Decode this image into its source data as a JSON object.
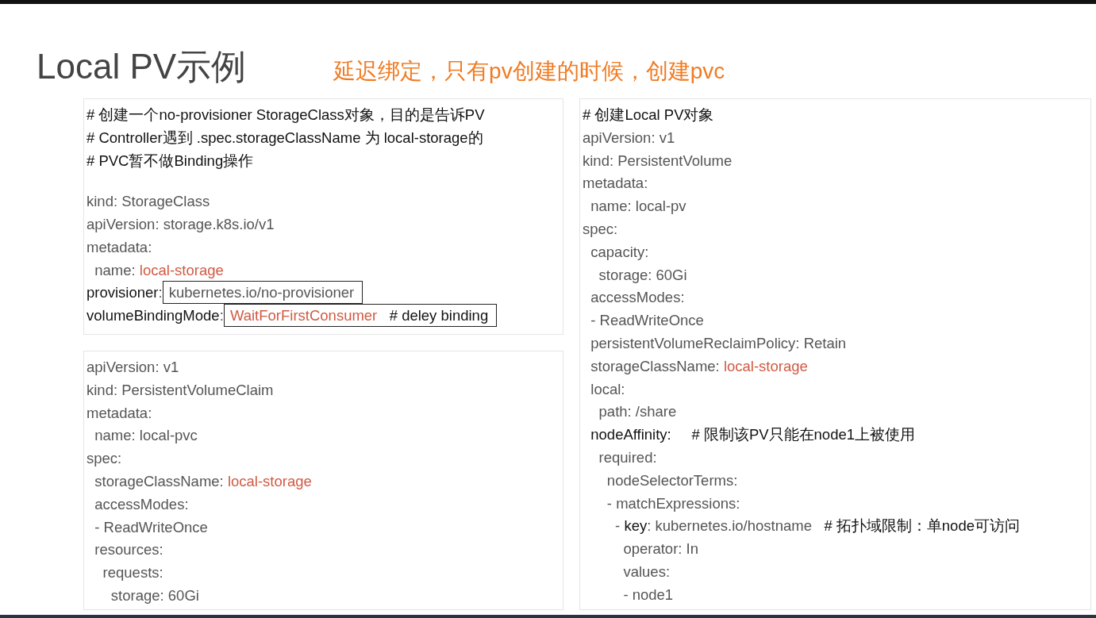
{
  "slide": {
    "title": "Local PV示例",
    "note": "延迟绑定，只有pv创建的时候，创建pvc",
    "left_panels": [
      {
        "lines": [
          {
            "kind": "code",
            "parts": [
              {
                "kind": "comment",
                "text": "# 创建一个no-provisioner StorageClass对象，目的是告诉PV"
              }
            ]
          },
          {
            "kind": "code",
            "parts": [
              {
                "kind": "comment",
                "text": "# Controller遇到 .spec.storageClassName 为 local-storage的"
              }
            ]
          },
          {
            "kind": "code",
            "parts": [
              {
                "kind": "comment",
                "text": "# PVC暂不做Binding操作"
              }
            ]
          },
          {
            "kind": "blank"
          },
          {
            "kind": "code",
            "parts": [
              {
                "kind": "plain",
                "text": "kind: StorageClass"
              }
            ]
          },
          {
            "kind": "code",
            "parts": [
              {
                "kind": "plain",
                "text": "apiVersion: storage.k8s.io/v1"
              }
            ]
          },
          {
            "kind": "code",
            "parts": [
              {
                "kind": "plain",
                "text": "metadata:"
              }
            ]
          },
          {
            "kind": "code",
            "parts": [
              {
                "kind": "plain",
                "text": "  name: "
              },
              {
                "kind": "value",
                "text": "local-storage"
              }
            ]
          },
          {
            "kind": "code",
            "parts": [
              {
                "kind": "key",
                "text": "provisioner"
              },
              {
                "kind": "plain",
                "text": ":"
              },
              {
                "kind": "box",
                "parts": [
                  {
                    "kind": "plain",
                    "text": " kubernetes.io/no-provisioner"
                  }
                ]
              }
            ]
          },
          {
            "kind": "code",
            "parts": [
              {
                "kind": "key",
                "text": "volumeBindingMode"
              },
              {
                "kind": "plain",
                "text": ":"
              },
              {
                "kind": "box",
                "parts": [
                  {
                    "kind": "value",
                    "text": " WaitForFirstConsumer"
                  },
                  {
                    "kind": "comment",
                    "text": "   # deley binding"
                  }
                ]
              }
            ]
          }
        ]
      },
      {
        "lines": [
          {
            "kind": "code",
            "parts": [
              {
                "kind": "plain",
                "text": "apiVersion: v1"
              }
            ]
          },
          {
            "kind": "code",
            "parts": [
              {
                "kind": "plain",
                "text": "kind: PersistentVolumeClaim"
              }
            ]
          },
          {
            "kind": "code",
            "parts": [
              {
                "kind": "plain",
                "text": "metadata:"
              }
            ]
          },
          {
            "kind": "code",
            "parts": [
              {
                "kind": "plain",
                "text": "  name: local-pvc"
              }
            ]
          },
          {
            "kind": "code",
            "parts": [
              {
                "kind": "plain",
                "text": "spec:"
              }
            ]
          },
          {
            "kind": "code",
            "parts": [
              {
                "kind": "plain",
                "text": "  storageClassName: "
              },
              {
                "kind": "value",
                "text": "local-storage"
              }
            ]
          },
          {
            "kind": "code",
            "parts": [
              {
                "kind": "plain",
                "text": "  accessModes:"
              }
            ]
          },
          {
            "kind": "code",
            "parts": [
              {
                "kind": "plain",
                "text": "  - ReadWriteOnce"
              }
            ]
          },
          {
            "kind": "code",
            "parts": [
              {
                "kind": "plain",
                "text": "  resources:"
              }
            ]
          },
          {
            "kind": "code",
            "parts": [
              {
                "kind": "plain",
                "text": "    requests:"
              }
            ]
          },
          {
            "kind": "code",
            "parts": [
              {
                "kind": "plain",
                "text": "      storage: 60Gi"
              }
            ]
          }
        ]
      }
    ],
    "right_panel": {
      "lines": [
        {
          "kind": "code",
          "parts": [
            {
              "kind": "comment",
              "text": "# 创建Local PV对象"
            }
          ]
        },
        {
          "kind": "code",
          "parts": [
            {
              "kind": "plain",
              "text": "apiVersion: v1"
            }
          ]
        },
        {
          "kind": "code",
          "parts": [
            {
              "kind": "plain",
              "text": "kind: PersistentVolume"
            }
          ]
        },
        {
          "kind": "code",
          "parts": [
            {
              "kind": "plain",
              "text": "metadata:"
            }
          ]
        },
        {
          "kind": "code",
          "parts": [
            {
              "kind": "plain",
              "text": "  name: local-pv"
            }
          ]
        },
        {
          "kind": "code",
          "parts": [
            {
              "kind": "plain",
              "text": "spec:"
            }
          ]
        },
        {
          "kind": "code",
          "parts": [
            {
              "kind": "plain",
              "text": "  capacity:"
            }
          ]
        },
        {
          "kind": "code",
          "parts": [
            {
              "kind": "plain",
              "text": "    storage: 60Gi"
            }
          ]
        },
        {
          "kind": "code",
          "parts": [
            {
              "kind": "plain",
              "text": "  accessModes:"
            }
          ]
        },
        {
          "kind": "code",
          "parts": [
            {
              "kind": "plain",
              "text": "  - ReadWriteOnce"
            }
          ]
        },
        {
          "kind": "code",
          "parts": [
            {
              "kind": "plain",
              "text": "  persistentVolumeReclaimPolicy: Retain"
            }
          ]
        },
        {
          "kind": "code",
          "parts": [
            {
              "kind": "plain",
              "text": "  storageClassName: "
            },
            {
              "kind": "value",
              "text": "local-storage"
            }
          ]
        },
        {
          "kind": "code",
          "parts": [
            {
              "kind": "plain",
              "text": "  local:"
            }
          ]
        },
        {
          "kind": "code",
          "parts": [
            {
              "kind": "plain",
              "text": "    path: /share"
            }
          ]
        },
        {
          "kind": "code",
          "parts": [
            {
              "kind": "key",
              "text": "  nodeAffinity:"
            },
            {
              "kind": "comment",
              "text": "     # 限制该PV只能在node1上被使用"
            }
          ]
        },
        {
          "kind": "code",
          "parts": [
            {
              "kind": "plain",
              "text": "    required:"
            }
          ]
        },
        {
          "kind": "code",
          "parts": [
            {
              "kind": "plain",
              "text": "      nodeSelectorTerms:"
            }
          ]
        },
        {
          "kind": "code",
          "parts": [
            {
              "kind": "plain",
              "text": "      - matchExpressions:"
            }
          ]
        },
        {
          "kind": "code",
          "parts": [
            {
              "kind": "plain",
              "text": "        - "
            },
            {
              "kind": "key",
              "text": "key"
            },
            {
              "kind": "plain",
              "text": ": kubernetes.io/hostname"
            },
            {
              "kind": "comment",
              "text": "   # 拓扑域限制：单node可访问"
            }
          ]
        },
        {
          "kind": "code",
          "parts": [
            {
              "kind": "plain",
              "text": "          operator: In"
            }
          ]
        },
        {
          "kind": "code",
          "parts": [
            {
              "kind": "plain",
              "text": "          values:"
            }
          ]
        },
        {
          "kind": "code",
          "parts": [
            {
              "kind": "plain",
              "text": "          - node1"
            }
          ]
        }
      ]
    }
  }
}
